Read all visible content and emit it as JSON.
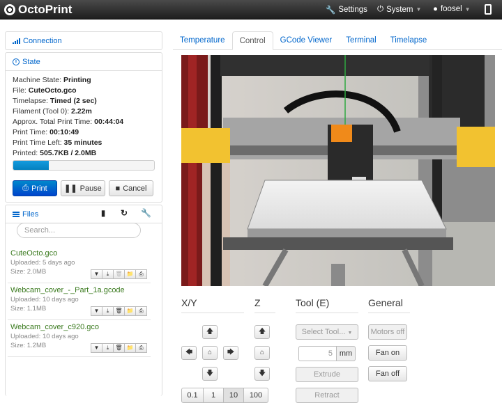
{
  "navbar": {
    "brand": "OctoPrint",
    "settings": "Settings",
    "system": "System",
    "user": "foosel"
  },
  "connection": {
    "title": "Connection"
  },
  "state": {
    "title": "State",
    "lines": [
      {
        "label": "Machine State: ",
        "value": "Printing"
      },
      {
        "label": "File: ",
        "value": "CuteOcto.gco"
      },
      {
        "label": "Timelapse: ",
        "value": "Timed (2 sec)"
      },
      {
        "label": "Filament (Tool 0): ",
        "value": "2.22m"
      },
      {
        "label": "Approx. Total Print Time: ",
        "value": "00:44:04"
      },
      {
        "label": "Print Time: ",
        "value": "00:10:49"
      },
      {
        "label": "Print Time Left: ",
        "value": "35 minutes"
      },
      {
        "label": "Printed: ",
        "value": "505.7KB / 2.0MB"
      }
    ],
    "progress_fraction": 0.25,
    "buttons": {
      "print": "Print",
      "pause": "Pause",
      "cancel": "Cancel"
    }
  },
  "files": {
    "title": "Files",
    "search_placeholder": "Search...",
    "items": [
      {
        "name": "CuteOcto.gco",
        "uploaded": "Uploaded: 5 days ago",
        "size": "Size: 2.0MB"
      },
      {
        "name": "Webcam_cover_-_Part_1a.gcode",
        "uploaded": "Uploaded: 10 days ago",
        "size": "Size: 1.1MB"
      },
      {
        "name": "Webcam_cover_c920.gco",
        "uploaded": "Uploaded: 10 days ago",
        "size": "Size: 1.2MB"
      }
    ]
  },
  "tabs": [
    "Temperature",
    "Control",
    "GCode Viewer",
    "Terminal",
    "Timelapse"
  ],
  "active_tab": "Control",
  "control": {
    "xy_title": "X/Y",
    "z_title": "Z",
    "tool_title": "Tool (E)",
    "general_title": "General",
    "steps": [
      "0.1",
      "1",
      "10",
      "100"
    ],
    "select_tool": "Select Tool...",
    "extrude_amount": "5",
    "extrude_unit": "mm",
    "extrude": "Extrude",
    "retract": "Retract",
    "motors_off": "Motors off",
    "fan_on": "Fan on",
    "fan_off": "Fan off"
  },
  "colors": {
    "link": "#0066cc",
    "file_name": "#3a7a1e",
    "primary": "#0055cc",
    "progress": "#149bdf"
  }
}
